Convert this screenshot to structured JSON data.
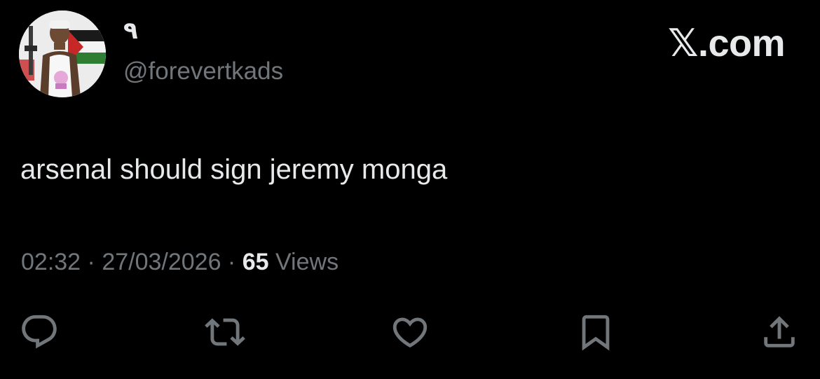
{
  "tweet": {
    "display_name": "٩",
    "handle": "@forevertkads",
    "text": "arsenal should sign jeremy monga",
    "time": "02:32",
    "separator": " · ",
    "date": "27/03/2026",
    "views_count": "65",
    "views_label": "Views"
  },
  "brand": {
    "text": "𝕏.com"
  },
  "actions": {
    "icons": [
      "reply-icon",
      "repost-icon",
      "like-icon",
      "bookmark-icon",
      "share-icon"
    ]
  },
  "colors": {
    "background": "#000000",
    "primary_text": "#e7e9ea",
    "secondary_text": "#71767b",
    "icon": "#71767b"
  }
}
